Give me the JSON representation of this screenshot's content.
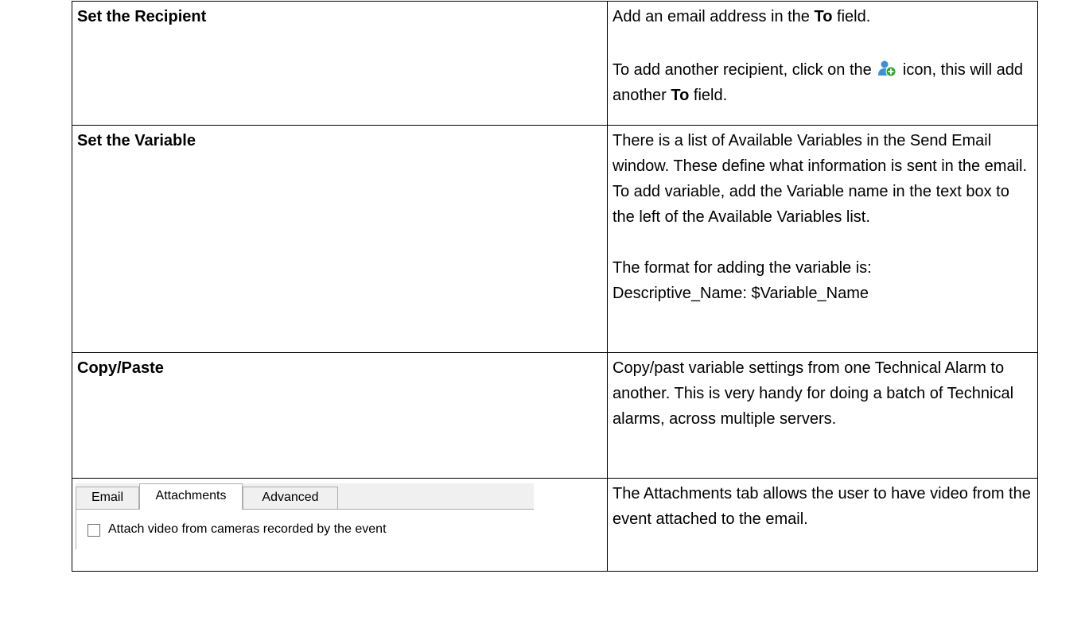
{
  "rows": [
    {
      "heading": "Set the Recipient",
      "desc": {
        "p1_pre": "Add an email address in the ",
        "p1_bold": "To",
        "p1_post": " field.",
        "p2_pre": "To add another recipient, click on the ",
        "p2_icon": "add-user-icon",
        "p2_mid": " icon, this will add another ",
        "p2_bold": "To",
        "p2_post": " field."
      }
    },
    {
      "heading": "Set the Variable",
      "desc": {
        "p1": "There is a list of Available Variables in the Send Email window. These define what information is sent in the email. To add variable, add the Variable name in the text box to the left of the Available Variables list.",
        "p2_line1": "The format for adding the variable is:",
        "p2_line2": "Descriptive_Name: $Variable_Name"
      }
    },
    {
      "heading": "Copy/Paste",
      "desc": {
        "p1": "Copy/past variable settings from one Technical Alarm to another. This is very handy for doing a batch of Technical alarms, across multiple servers."
      }
    },
    {
      "tabs": [
        "Email",
        "Attachments",
        "Advanced"
      ],
      "active_tab": "Attachments",
      "checkbox_label": "Attach video from cameras recorded by the event",
      "checkbox_checked": false,
      "desc": {
        "p1": "The Attachments tab allows the user to have video from the event attached to the email."
      }
    }
  ],
  "colors": {
    "border": "#000000",
    "tab_border": "#adadad",
    "tab_bg": "#f0f0f0",
    "icon_blue": "#3d8fd6",
    "icon_green": "#2aa52a"
  }
}
